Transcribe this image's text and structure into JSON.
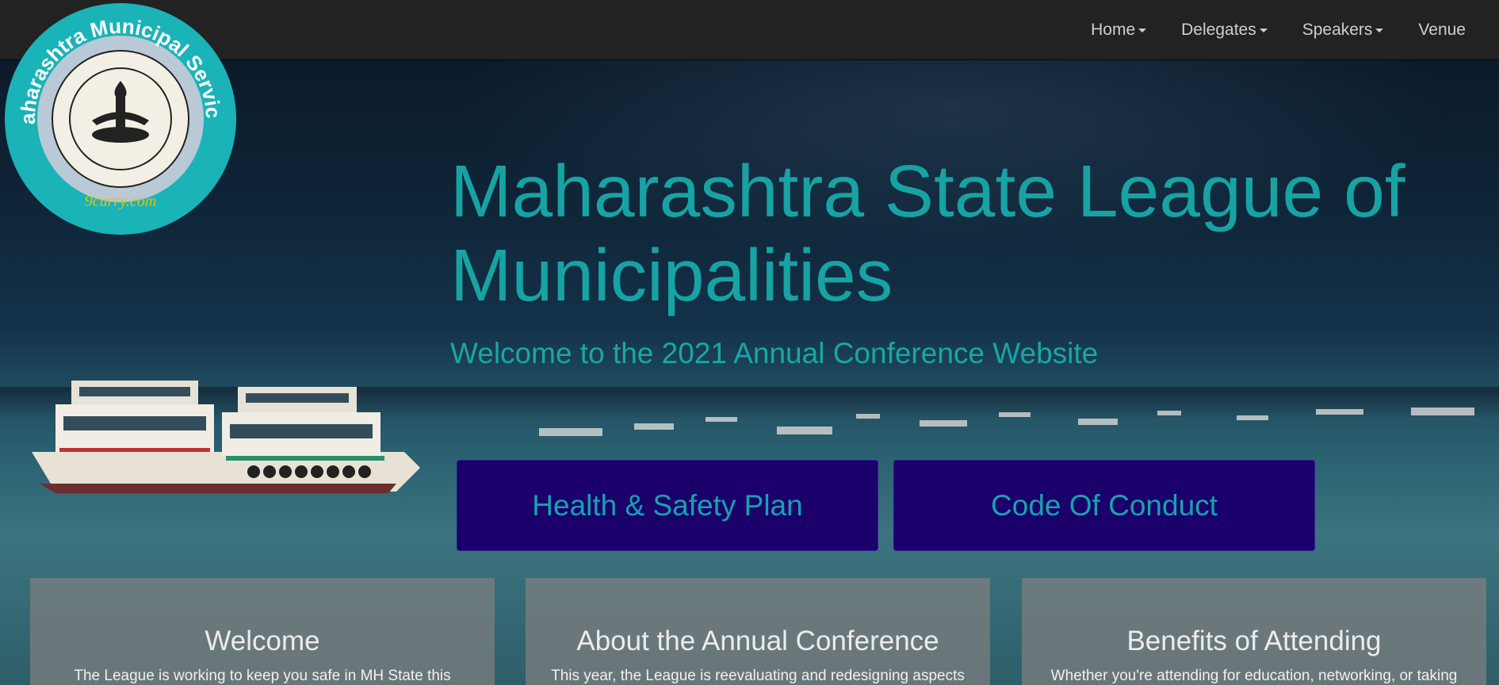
{
  "nav": {
    "items": [
      {
        "label": "Home",
        "dropdown": true
      },
      {
        "label": "Delegates",
        "dropdown": true
      },
      {
        "label": "Speakers",
        "dropdown": true
      },
      {
        "label": "Venue",
        "dropdown": false
      }
    ]
  },
  "logo": {
    "text": "Maharashtra Municipal Services",
    "watermark": "9curry.com"
  },
  "hero": {
    "title_line1": "Maharashtra State League of",
    "title_line2": "Municipalities",
    "subtitle": "Welcome to the 2021 Annual Conference Website"
  },
  "buttons": {
    "health": "Health & Safety Plan",
    "conduct": "Code Of Conduct"
  },
  "cards": [
    {
      "title": "Welcome",
      "text": "The League is working to keep you safe in MH State this"
    },
    {
      "title": "About the Annual Conference",
      "text": "This year, the League is reevaluating and redesigning aspects"
    },
    {
      "title": "Benefits of Attending",
      "text": "Whether you're attending for education, networking, or taking"
    }
  ],
  "colors": {
    "accent": "#17a3a3",
    "navbar": "#222222",
    "button_bg": "#1b006b",
    "card_bg": "#808080"
  }
}
